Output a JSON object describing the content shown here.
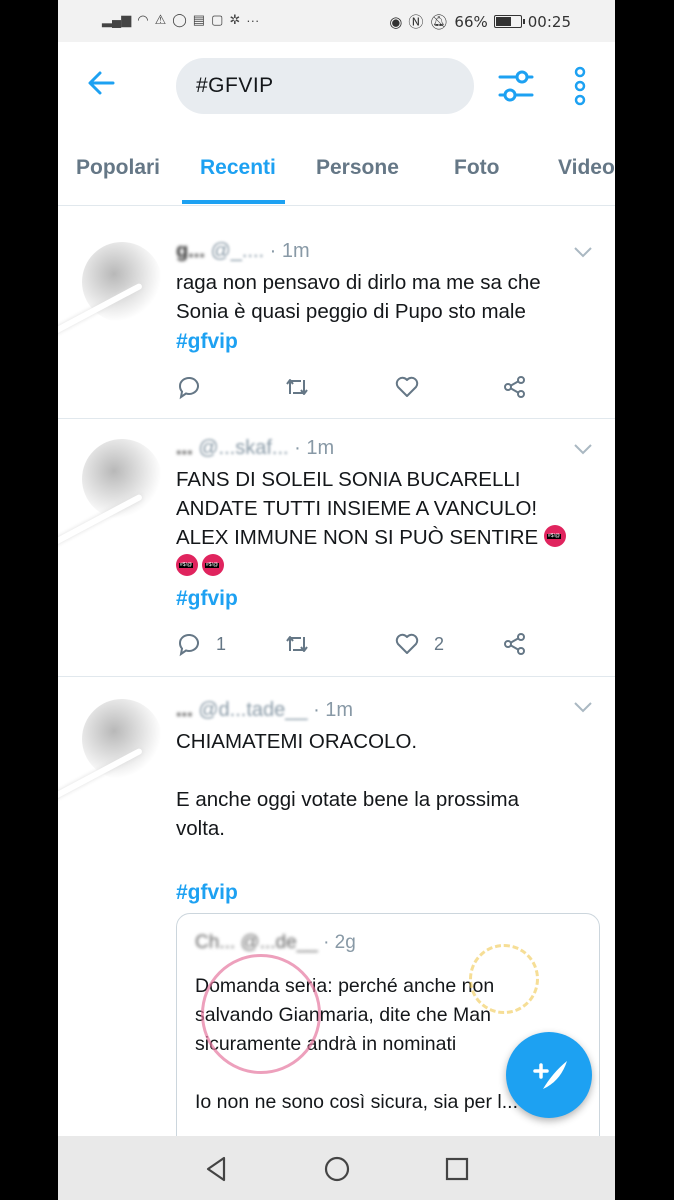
{
  "status_bar": {
    "battery": "66%",
    "time": "00:25",
    "battery_level": 0.66
  },
  "header": {
    "search_text": "#GFVIP"
  },
  "tabs": [
    {
      "label": "Popolari",
      "active": false
    },
    {
      "label": "Recenti",
      "active": true
    },
    {
      "label": "Persone",
      "active": false
    },
    {
      "label": "Foto",
      "active": false
    },
    {
      "label": "Video",
      "active": false
    }
  ],
  "tweets": [
    {
      "name": "g...",
      "handle": "@_....",
      "time": "· 1m",
      "text": "raga non pensavo di dirlo ma me sa che\nSonia è quasi peggio di Pupo sto male",
      "hashtag": "#gfvip",
      "replies": "",
      "likes": ""
    },
    {
      "name": "...",
      "handle": "@...skaf...",
      "time": "· 1m",
      "text": "FANS DI SOLEIL SONIA BUCARELLI\nANDATE TUTTI INSIEME A VANCULO!\nALEX IMMUNE NON SI PUÒ SENTIRE",
      "hashtag": "#gfvip",
      "replies": "1",
      "likes": "2"
    },
    {
      "name": "...",
      "handle": "@d...tade__",
      "time": "· 1m",
      "text": "CHIAMATEMI ORACOLO.\n\nE anche oggi votate bene la prossima\nvolta.",
      "hashtag": "#gfvip",
      "replies": "",
      "likes": ""
    }
  ],
  "quoted_tweet": {
    "meta_blurred": "Ch... @...de__",
    "time": "· 2g",
    "text": "Domanda seria: perché anche non\nsalvando Gianmaria, dite che Man\nsicuramente andrà in nominati\n\nIo non ne sono così sicura, sia per l..."
  },
  "colors": {
    "accent": "#1da1f2",
    "text": "#14171a",
    "muted": "#657786"
  }
}
